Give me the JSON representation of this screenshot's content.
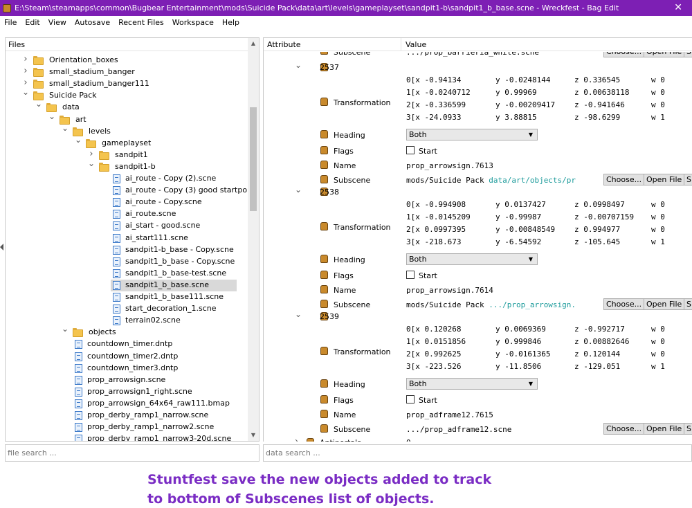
{
  "window": {
    "title": "E:\\Steam\\steamapps\\common\\Bugbear Entertainment\\mods\\Suicide Pack\\data\\art\\levels\\gameplayset\\sandpit1-b\\sandpit1_b_base.scne - Wreckfest - Bag Edit",
    "close_glyph": "✕"
  },
  "menu": [
    "File",
    "Edit",
    "View",
    "Autosave",
    "Recent Files",
    "Workspace",
    "Help"
  ],
  "files_panel": {
    "header": "Files",
    "tree": [
      {
        "type": "folder",
        "depth": 2,
        "label": "Orientation_boxes",
        "expand": "collapsed"
      },
      {
        "type": "folder",
        "depth": 2,
        "label": "small_stadium_banger",
        "expand": "collapsed"
      },
      {
        "type": "folder",
        "depth": 2,
        "label": "small_stadium_banger111",
        "expand": "collapsed"
      },
      {
        "type": "folder",
        "depth": 2,
        "label": "Suicide Pack",
        "expand": "expanded"
      },
      {
        "type": "folder",
        "depth": 3,
        "label": "data",
        "expand": "expanded"
      },
      {
        "type": "folder",
        "depth": 4,
        "label": "art",
        "expand": "expanded"
      },
      {
        "type": "folder",
        "depth": 5,
        "label": "levels",
        "expand": "expanded"
      },
      {
        "type": "folder",
        "depth": 6,
        "label": "gameplayset",
        "expand": "expanded"
      },
      {
        "type": "folder",
        "depth": 7,
        "label": "sandpit1",
        "expand": "collapsed"
      },
      {
        "type": "folder",
        "depth": 7,
        "label": "sandpit1-b",
        "expand": "expanded"
      },
      {
        "type": "file",
        "depth": 8,
        "label": "ai_route - Copy (2).scne"
      },
      {
        "type": "file",
        "depth": 8,
        "label": "ai_route - Copy (3) good startpo..."
      },
      {
        "type": "file",
        "depth": 8,
        "label": "ai_route - Copy.scne"
      },
      {
        "type": "file",
        "depth": 8,
        "label": "ai_route.scne"
      },
      {
        "type": "file",
        "depth": 8,
        "label": "ai_start - good.scne"
      },
      {
        "type": "file",
        "depth": 8,
        "label": "ai_start111.scne"
      },
      {
        "type": "file",
        "depth": 8,
        "label": "sandpit1-b_base - Copy.scne"
      },
      {
        "type": "file",
        "depth": 8,
        "label": "sandpit1_b_base - Copy.scne"
      },
      {
        "type": "file",
        "depth": 8,
        "label": "sandpit1_b_base-test.scne"
      },
      {
        "type": "file",
        "depth": 8,
        "label": "sandpit1_b_base.scne",
        "selected": true
      },
      {
        "type": "file",
        "depth": 8,
        "label": "sandpit1_b_base111.scne"
      },
      {
        "type": "file",
        "depth": 8,
        "label": "start_decoration_1.scne"
      },
      {
        "type": "file",
        "depth": 8,
        "label": "terrain02.scne"
      },
      {
        "type": "folder",
        "depth": 5,
        "label": "objects",
        "expand": "expanded"
      },
      {
        "type": "file",
        "depth": 6,
        "label": "countdown_timer.dntp"
      },
      {
        "type": "file",
        "depth": 6,
        "label": "countdown_timer2.dntp"
      },
      {
        "type": "file",
        "depth": 6,
        "label": "countdown_timer3.dntp"
      },
      {
        "type": "file",
        "depth": 6,
        "label": "prop_arrowsign.scne"
      },
      {
        "type": "file",
        "depth": 6,
        "label": "prop_arrowsign1_right.scne"
      },
      {
        "type": "file",
        "depth": 6,
        "label": "prop_arrowsign_64x64_raw111.bmap"
      },
      {
        "type": "file",
        "depth": 6,
        "label": "prop_derby_ramp1_narrow.scne"
      },
      {
        "type": "file",
        "depth": 6,
        "label": "prop_derby_ramp1_narrow2.scne"
      },
      {
        "type": "file",
        "depth": 6,
        "label": "prop_derby_ramp1_narrow3-20d.scne"
      }
    ],
    "search_placeholder": "file search ..."
  },
  "attr_panel": {
    "col_attribute": "Attribute",
    "col_value": "Value",
    "top_partial": {
      "name": "Subscene",
      "value": ".../prop_barrieria_white.scne"
    },
    "buttons": {
      "choose": "Choose...",
      "open": "Open File",
      "show": "Sh"
    },
    "groups": [
      {
        "id": "2537",
        "transform": [
          [
            "0[x -0.94134",
            "y -0.0248144",
            "z 0.336545",
            "w 0"
          ],
          [
            "1[x -0.0240712",
            "y 0.99969",
            "z 0.00638118",
            "w 0"
          ],
          [
            "2[x -0.336599",
            "y -0.00209417",
            "z -0.941646",
            "w 0"
          ],
          [
            "3[x -24.0933",
            "y 3.88815",
            "z -98.6299",
            "w 1"
          ]
        ],
        "heading": "Both",
        "flags": "Start",
        "name": "prop_arrowsign.7613",
        "subscene_prefix": "mods/Suicide Pack ",
        "subscene_link": "data/art/objects/pr"
      },
      {
        "id": "2538",
        "transform": [
          [
            "0[x -0.994908",
            "y 0.0137427",
            "z 0.0998497",
            "w 0"
          ],
          [
            "1[x -0.0145209",
            "y -0.99987",
            "z -0.00707159",
            "w 0"
          ],
          [
            "2[x 0.0997395",
            "y -0.00848549",
            "z 0.994977",
            "w 0"
          ],
          [
            "3[x -218.673",
            "y -6.54592",
            "z -105.645",
            "w 1"
          ]
        ],
        "heading": "Both",
        "flags": "Start",
        "name": "prop_arrowsign.7614",
        "subscene_prefix": "mods/Suicide Pack ",
        "subscene_link": ".../prop_arrowsign."
      },
      {
        "id": "2539",
        "transform": [
          [
            "0[x 0.120268",
            "y 0.0069369",
            "z -0.992717",
            "w 0"
          ],
          [
            "1[x 0.0151856",
            "y 0.999846",
            "z 0.00882646",
            "w 0"
          ],
          [
            "2[x 0.992625",
            "y -0.0161365",
            "z 0.120144",
            "w 0"
          ],
          [
            "3[x -223.526",
            "y -11.8506",
            "z -129.051",
            "w 1"
          ]
        ],
        "heading": "Both",
        "flags": "Start",
        "name": "prop_adframe12.7615",
        "subscene_prefix": "",
        "subscene_link": "",
        "subscene_plain": ".../prop_adframe12.scne"
      }
    ],
    "labels": {
      "transformation": "Transformation",
      "heading": "Heading",
      "flags": "Flags",
      "name": "Name",
      "subscene": "Subscene"
    },
    "bottom_partial": {
      "name": "Antiportals",
      "value": "0"
    },
    "search_placeholder": "data search ..."
  },
  "caption": {
    "line1": "Stuntfest save the new objects added to track",
    "line2": "to bottom of Subscenes list of objects."
  }
}
